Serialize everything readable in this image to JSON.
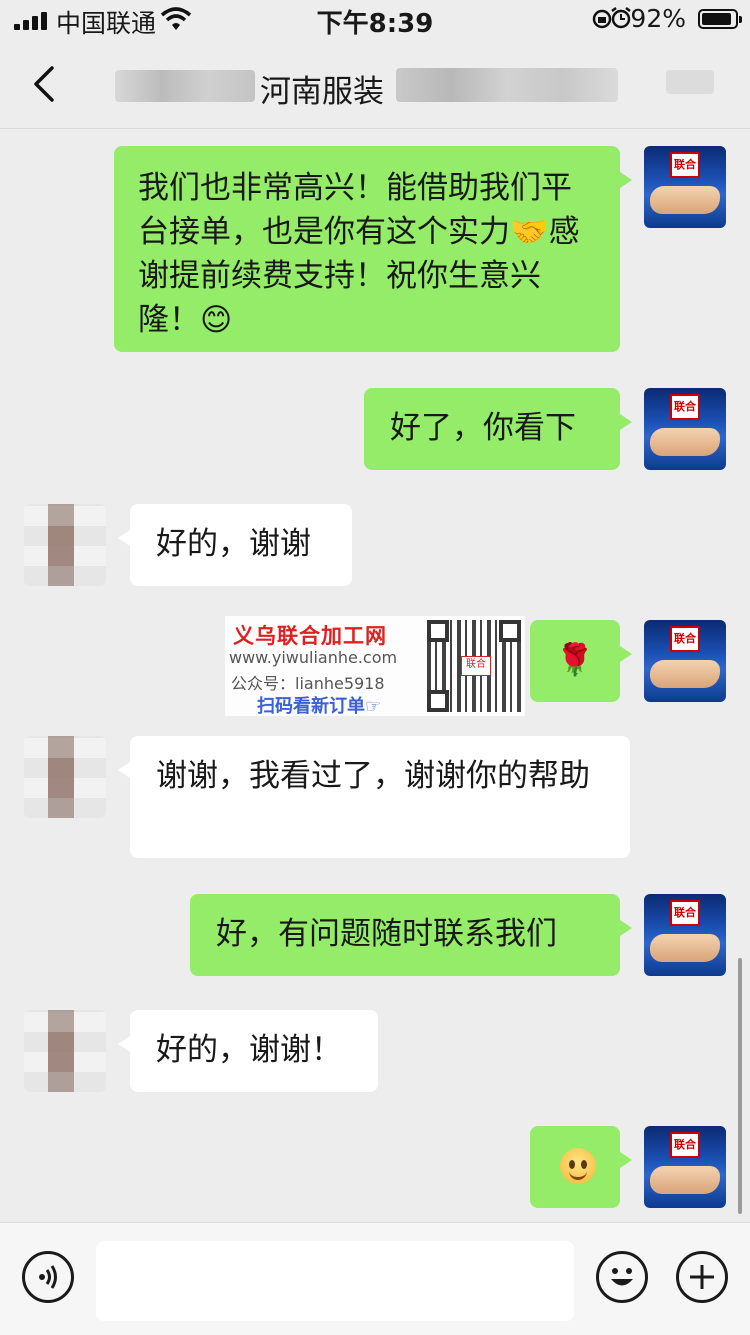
{
  "status_bar": {
    "carrier": "中国联通",
    "time": "下午8:39",
    "battery_percent": "92%",
    "battery_level": 0.92
  },
  "nav": {
    "title_visible": "河南服装"
  },
  "messages": [
    {
      "from": "me",
      "text": "我们也非常高兴！能借助我们平台接单，也是你有这个实力🤝感谢提前续费支持！祝你生意兴隆！😊"
    },
    {
      "from": "me",
      "text": "好了，你看下"
    },
    {
      "from": "other",
      "text": "好的，谢谢"
    },
    {
      "from": "me",
      "text": "🌹"
    },
    {
      "from": "other",
      "text": "谢谢，我看过了，谢谢你的帮助"
    },
    {
      "from": "me",
      "text": "好，有问题随时联系我们"
    },
    {
      "from": "other",
      "text": "好的，谢谢！"
    },
    {
      "from": "me",
      "emoji": "smiling-face"
    }
  ],
  "watermark": {
    "title": "义乌联合加工网",
    "url": "www.yiwulianhe.com",
    "account": "公众号：lianhe5918",
    "scan": "扫码看新订单☞",
    "qr_mark": "联合"
  },
  "avatar_badge": "联合",
  "icons": [
    "back-icon",
    "voice-icon",
    "emoji-icon",
    "plus-icon",
    "signal-icon",
    "wifi-icon",
    "lock-rotation-icon",
    "alarm-icon",
    "battery-icon"
  ]
}
